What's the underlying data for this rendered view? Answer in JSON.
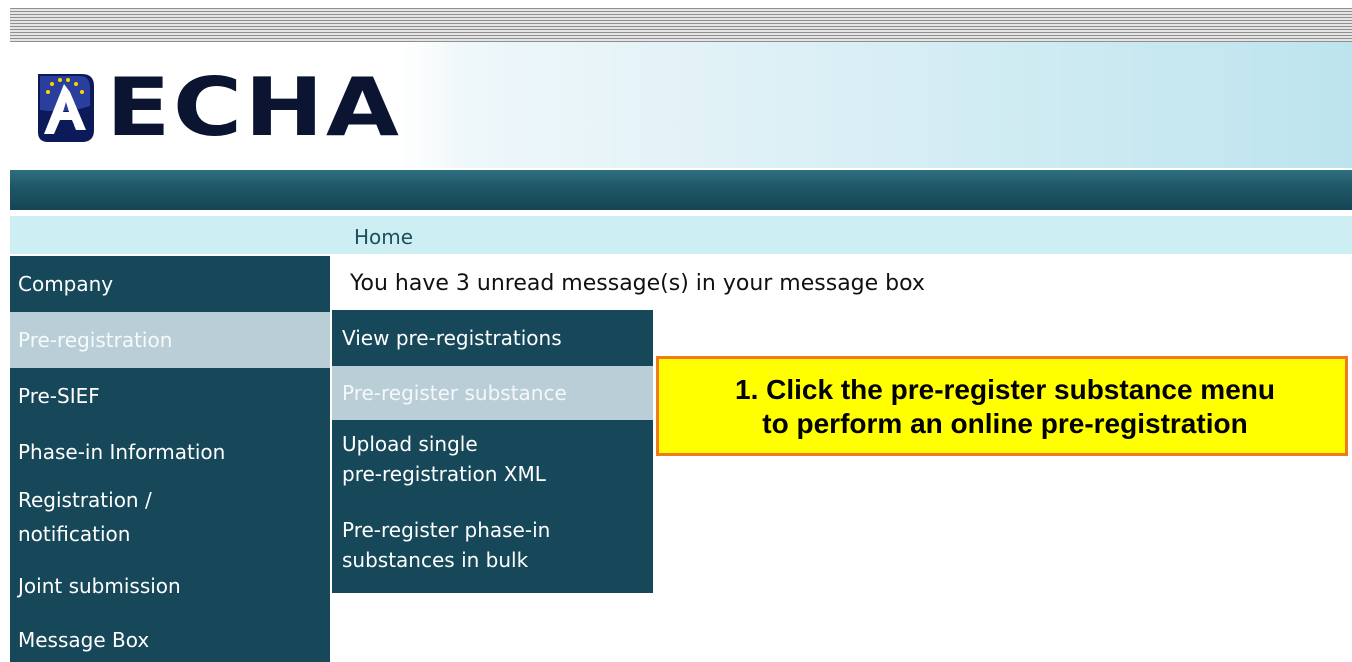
{
  "header": {
    "logo_text": "ECHA",
    "logo_icon": "echa-emblem-icon"
  },
  "breadcrumb": {
    "label": "Home"
  },
  "sidebar": {
    "items": [
      {
        "label": "Company",
        "active": false
      },
      {
        "label": "Pre-registration",
        "active": true
      },
      {
        "label": "Pre-SIEF",
        "active": false
      },
      {
        "label": "Phase-in Information",
        "active": false
      },
      {
        "label": "Registration / notification",
        "lines": [
          "Registration /",
          "notification"
        ],
        "active": false
      },
      {
        "label": "Joint submission",
        "active": false
      },
      {
        "label": "Message Box",
        "active": false
      }
    ]
  },
  "submenu": {
    "items": [
      {
        "label": "View pre-registrations",
        "active": false
      },
      {
        "label": "Pre-register substance",
        "active": true
      },
      {
        "label": "Upload single pre-registration XML",
        "lines": [
          "Upload single",
          "pre-registration XML"
        ],
        "active": false
      },
      {
        "label": "Pre-register phase-in substances in bulk",
        "lines": [
          "Pre-register phase-in",
          "substances in bulk"
        ],
        "active": false
      }
    ]
  },
  "main": {
    "message": "You have 3 unread message(s) in your message box"
  },
  "callout": {
    "lines": [
      "1. Click the pre-register substance menu",
      "to perform an online pre-registration"
    ]
  },
  "colors": {
    "nav_dark": "#16485a",
    "nav_active": "#b9ced6",
    "breadcrumb_bg": "#cdeef3",
    "callout_bg": "#ffff00",
    "callout_border": "#f07a1c"
  }
}
